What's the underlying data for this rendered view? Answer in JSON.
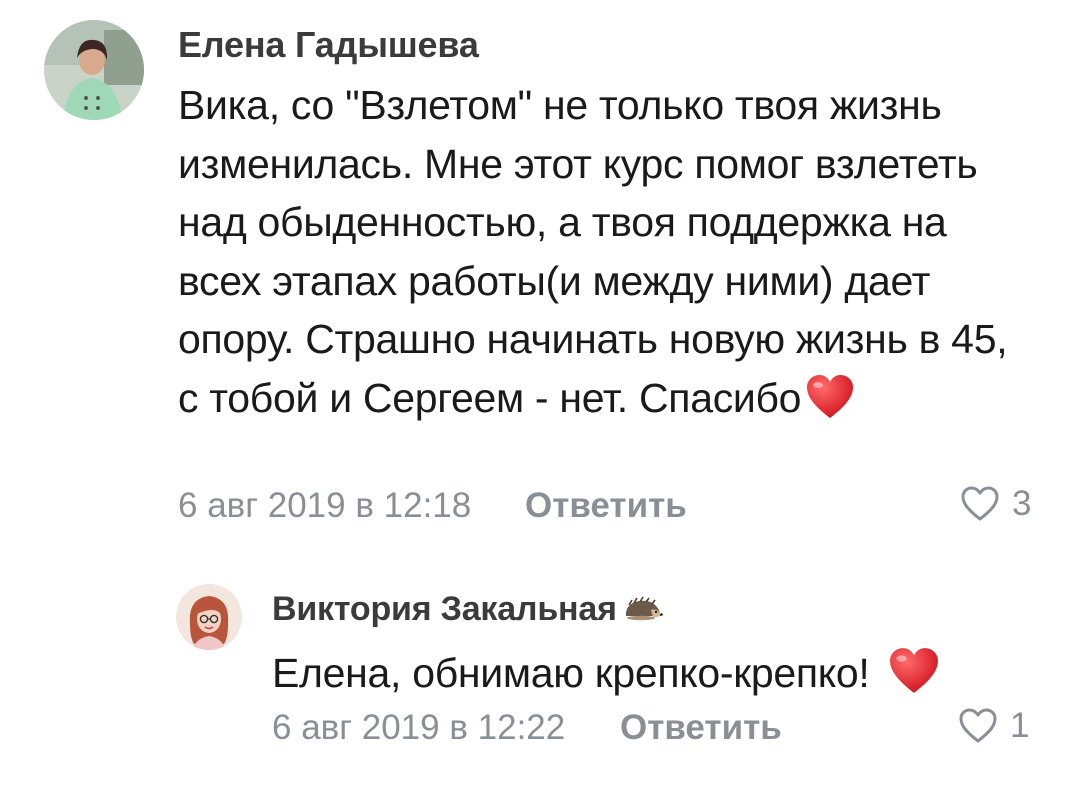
{
  "comments": [
    {
      "author": "Елена Гадышева",
      "text": "Вика, со \"Взлетом\" не только твоя жизнь изменилась. Мне этот курс помог взлететь над обыденностью, а твоя поддержка на всех этапах работы(и между ними) дает опору. Страшно начинать новую жизнь в 45, с тобой и Сергеем - нет. Спасибо",
      "emoji": "heart-emoji",
      "date": "6 авг 2019 в 12:18",
      "reply_label": "Ответить",
      "likes": "3"
    }
  ],
  "replies": [
    {
      "author": "Виктория Закальная",
      "author_emoji": "hedgehog-emoji",
      "text": "Елена, обнимаю крепко-крепко!",
      "emoji": "heart-emoji",
      "date": "6 авг 2019 в 12:22",
      "reply_label": "Ответить",
      "likes": "1"
    }
  ],
  "colors": {
    "meta": "#8a8f96",
    "author": "#3b3b3b",
    "heart": "#e8222e"
  }
}
